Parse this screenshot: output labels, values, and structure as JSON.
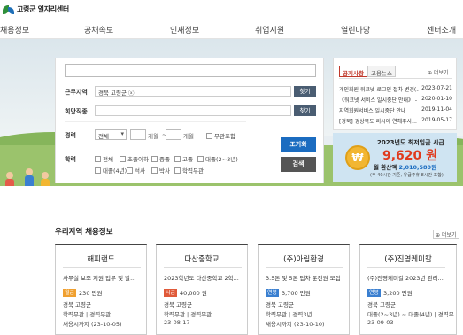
{
  "header": {
    "logo_text": "고령군 일자리센터",
    "nav": [
      "채용정보",
      "공채속보",
      "인재정보",
      "취업지원",
      "열린마당",
      "센터소개"
    ]
  },
  "search": {
    "keyword_value": "",
    "region_label": "근무지역",
    "region_value": "경북 고령군",
    "region_remove": "ⓧ",
    "region_button": "찾기",
    "job_label": "희망직종",
    "job_value": "",
    "job_button": "찾기",
    "career_label": "경력",
    "career_select": "전체",
    "months_1": "개월",
    "dash": "~",
    "months_2": "개월",
    "no_career": "무관포함",
    "edu_label": "학력",
    "edu_options": [
      "전체",
      "초졸이하",
      "중졸",
      "고졸",
      "대졸(2~3년)",
      "대졸(4년)",
      "석사",
      "박사",
      "학력무관"
    ],
    "search_button": "조기화",
    "detail_button": "검색"
  },
  "notice": {
    "tabs": [
      "공지사항",
      "고용뉴스"
    ],
    "more": "더보기",
    "items": [
      {
        "title": "개인회원 워크넷 로그인 절차 변경(...",
        "date": "2023-07-21"
      },
      {
        "title": "《워크넷 서비스 일시중단 안내》 - ...",
        "date": "2020-01-10"
      },
      {
        "title": "지역회원서비스 일시중단 안내",
        "date": "2019-11-04"
      },
      {
        "title": "[경북] 경상북도 러시아 연해주사...",
        "date": "2019-05-17"
      }
    ]
  },
  "wage_banner": {
    "line1": "2023년도 최저임금 시급",
    "amount": "9,620 원",
    "line3_prefix": "월 환산액",
    "line3_amount": "2,010,580원",
    "line4": "(주 40시간 기준, 유급주휴 8시간 포함)",
    "coin": "₩"
  },
  "regional": {
    "title": "우리지역 채용정보",
    "more": "더보기",
    "colors": {
      "pay_orange": "#f0a030",
      "pay_red": "#e05a3a",
      "pay_blue": "#3a7fd0"
    },
    "cards": [
      {
        "company": "해피랜드",
        "title": "사무실 보조 지원 업무 및 발...",
        "badge": "월급",
        "wage": "230 만원",
        "region": "경북 고령군",
        "edu": "학력무관 | 경력무관",
        "deadline": "채용시까지 (23-10-05)"
      },
      {
        "company": "다산중학교",
        "title": "2023학년도 다산중학교 2학...",
        "badge": "시급",
        "wage": "40,000 원",
        "region": "경북 고령군",
        "edu": "학력무관 | 경력무관",
        "deadline": "23-08-17"
      },
      {
        "company": "(주)아림환경",
        "title": "3.5톤 및 5톤 탑차 운전원 모집",
        "badge": "연봉",
        "wage": "3,700 만원",
        "region": "경북 고령군",
        "edu": "학력무관 | 경력3년",
        "deadline": "채용시까지 (23-10-10)"
      },
      {
        "company": "(주)진영케미칼",
        "title": "(주)진영케미칼 2023년 관리...",
        "badge": "연봉",
        "wage": "3,200 만원",
        "region": "경북 고령군",
        "edu": "대졸(2~3년) ~ 대졸(4년) | 경력무",
        "deadline": "23-09-03"
      }
    ]
  }
}
